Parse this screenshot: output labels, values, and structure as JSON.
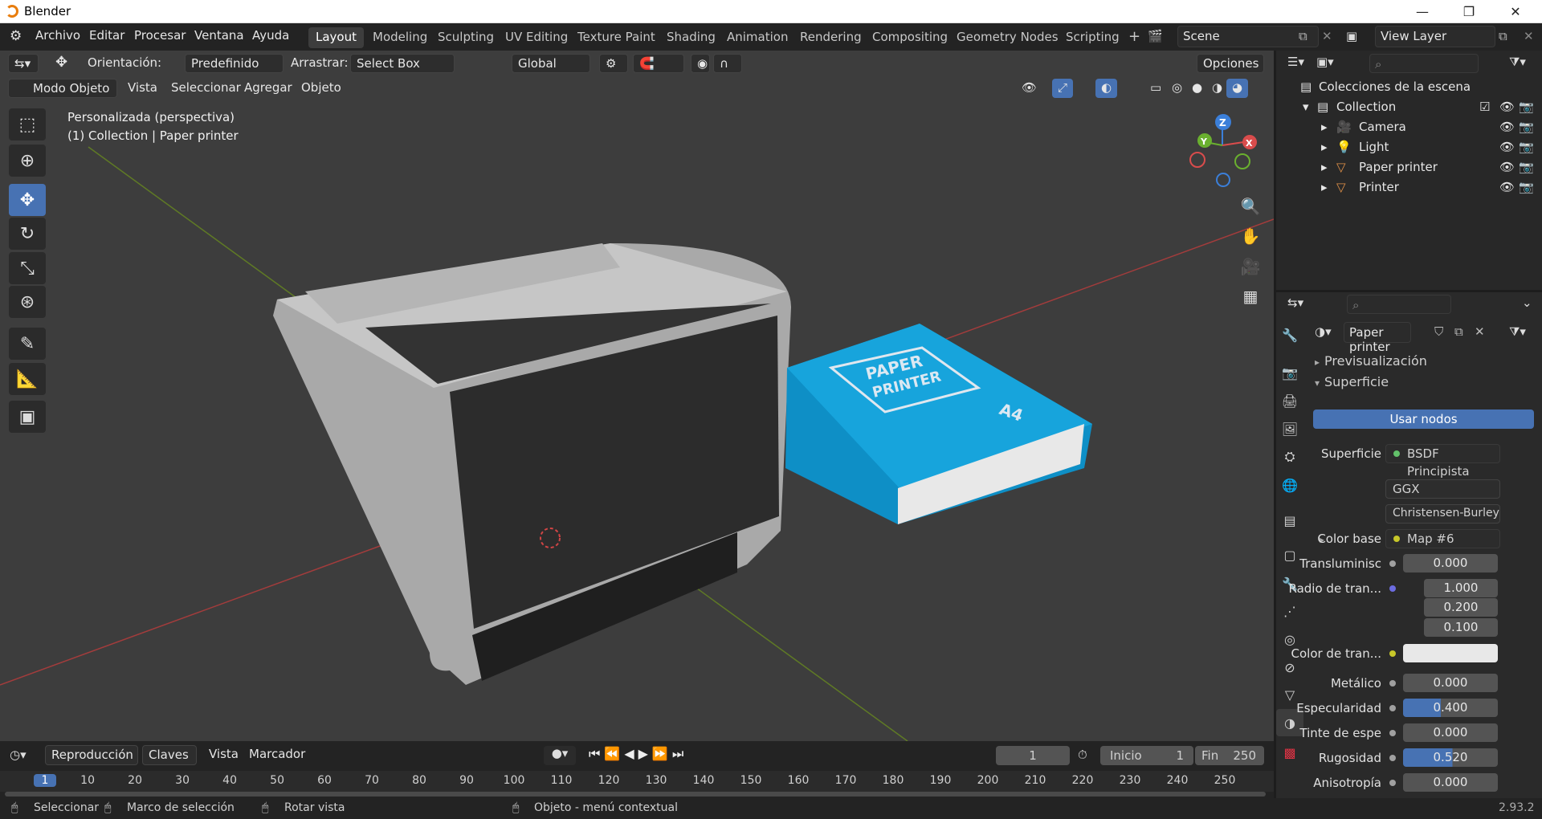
{
  "app": {
    "title": "Blender",
    "version": "2.93.2"
  },
  "window": {
    "minimize": "—",
    "maximize": "❐",
    "close": "✕"
  },
  "menu": [
    "Archivo",
    "Editar",
    "Procesar",
    "Ventana",
    "Ayuda"
  ],
  "workspaces": [
    "Layout",
    "Modeling",
    "Sculpting",
    "UV Editing",
    "Texture Paint",
    "Shading",
    "Animation",
    "Rendering",
    "Compositing",
    "Geometry Nodes",
    "Scripting"
  ],
  "active_workspace": "Layout",
  "scene": "Scene",
  "view_layer": "View Layer",
  "toolheader": {
    "orientation_label": "Orientación:",
    "orientation_value": "Predefinido",
    "drag_label": "Arrastrar:",
    "drag_value": "Select Box",
    "transform_space": "Global",
    "options": "Opciones"
  },
  "viewheader": {
    "mode": "Modo Objeto",
    "menus": [
      "Vista",
      "Seleccionar",
      "Agregar",
      "Objeto"
    ]
  },
  "viewport": {
    "line1": "Personalizada (perspectiva)",
    "line2": "(1) Collection | Paper printer",
    "paper_label_1": "PAPER",
    "paper_label_2": "PRINTER",
    "paper_size": "A4",
    "gizmo": {
      "x": "X",
      "y": "Y",
      "z": "Z"
    }
  },
  "outliner": {
    "title": "Colecciones de la escena",
    "collection": "Collection",
    "items": [
      "Camera",
      "Light",
      "Paper printer",
      "Printer"
    ]
  },
  "properties": {
    "material": "Paper printer",
    "preview": "Previsualización",
    "surface_panel": "Superficie",
    "use_nodes": "Usar nodos",
    "surface_label": "Superficie",
    "surface_value": "BSDF Principista",
    "distribution": "GGX",
    "subsurface_method": "Christensen-Burley",
    "base_color_label": "Color base",
    "base_color_value": "Map #6",
    "rows": [
      {
        "label": "Transluminisc",
        "value": "0.000"
      },
      {
        "label": "Radio de tran...",
        "value": "1.000"
      },
      {
        "label": "",
        "value": "0.200"
      },
      {
        "label": "",
        "value": "0.100"
      }
    ],
    "sub_color_label": "Color de tran...",
    "rows2": [
      {
        "label": "Metálico",
        "value": "0.000",
        "fill": 0
      },
      {
        "label": "Especularidad",
        "value": "0.400",
        "fill": 0.4
      },
      {
        "label": "Tinte de espe",
        "value": "0.000",
        "fill": 0
      },
      {
        "label": "Rugosidad",
        "value": "0.520",
        "fill": 0.52
      },
      {
        "label": "Anisotropía",
        "value": "0.000",
        "fill": 0
      }
    ]
  },
  "timeline": {
    "menus": [
      "Reproducción",
      "Claves",
      "Vista",
      "Marcador"
    ],
    "current_frame": "1",
    "start_label": "Inicio",
    "start": "1",
    "end_label": "Fin",
    "end": "250",
    "ticks": [
      "1",
      "10",
      "20",
      "30",
      "40",
      "50",
      "60",
      "70",
      "80",
      "90",
      "100",
      "110",
      "120",
      "130",
      "140",
      "150",
      "160",
      "170",
      "180",
      "190",
      "200",
      "210",
      "220",
      "230",
      "240",
      "250"
    ]
  },
  "status": {
    "select": "Seleccionar",
    "box": "Marco de selección",
    "rotate": "Rotar vista",
    "context": "Objeto - menú contextual"
  }
}
